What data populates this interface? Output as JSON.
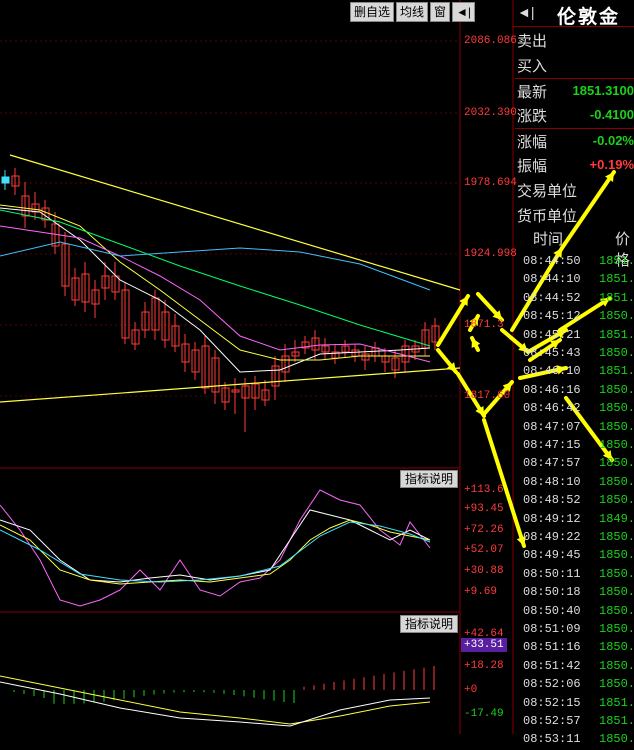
{
  "toolbar": {
    "buttons": [
      "删自选",
      "均线",
      "窗",
      "◄|"
    ]
  },
  "price_axis": [
    "2086.086",
    "2032.390",
    "1978.694",
    "1924.998",
    "1871.3",
    "1817.60"
  ],
  "indicator1": {
    "button": "指标说明",
    "labels": [
      "+113.6",
      "+93.45",
      "+72.26",
      "+52.07",
      "+30.88",
      "+9.69"
    ]
  },
  "indicator2": {
    "button": "指标说明",
    "labels": [
      "+42.64",
      "+33.51",
      "+18.28",
      "+0",
      "-17.49"
    ]
  },
  "quote_panel": {
    "title": "伦敦金",
    "rows": [
      {
        "label": "卖出",
        "value": ""
      },
      {
        "label": "买入",
        "value": ""
      },
      {
        "label": "最新",
        "value": "1851.3100",
        "color": "#19d219"
      },
      {
        "label": "涨跌",
        "value": "-0.4100",
        "color": "#19d219"
      },
      {
        "label": "涨幅",
        "value": "-0.02%",
        "color": "#19d219"
      },
      {
        "label": "振幅",
        "value": "+0.19%",
        "color": "#ff3b3b"
      },
      {
        "label": "交易单位",
        "value": ""
      },
      {
        "label": "货币单位",
        "value": ""
      }
    ]
  },
  "ticks": {
    "head_time": "时间",
    "head_price": "价格",
    "rows": [
      {
        "time": "08:44:50",
        "price": "1851."
      },
      {
        "time": "08:44:10",
        "price": "1851."
      },
      {
        "time": "08:44:52",
        "price": "1851."
      },
      {
        "time": "08:45:12",
        "price": "1850."
      },
      {
        "time": "08:45:21",
        "price": "1851."
      },
      {
        "time": "08:45:43",
        "price": "1850."
      },
      {
        "time": "08:46:10",
        "price": "1851."
      },
      {
        "time": "08:46:16",
        "price": "1850."
      },
      {
        "time": "08:46:42",
        "price": "1850."
      },
      {
        "time": "08:47:07",
        "price": "1850."
      },
      {
        "time": "08:47:15",
        "price": "1850."
      },
      {
        "time": "08:47:57",
        "price": "1850."
      },
      {
        "time": "08:48:10",
        "price": "1850."
      },
      {
        "time": "08:48:52",
        "price": "1850."
      },
      {
        "time": "08:49:12",
        "price": "1849."
      },
      {
        "time": "08:49:22",
        "price": "1850."
      },
      {
        "time": "08:49:45",
        "price": "1850."
      },
      {
        "time": "08:50:11",
        "price": "1850."
      },
      {
        "time": "08:50:18",
        "price": "1850."
      },
      {
        "time": "08:50:40",
        "price": "1850."
      },
      {
        "time": "08:51:09",
        "price": "1850."
      },
      {
        "time": "08:51:16",
        "price": "1850."
      },
      {
        "time": "08:51:42",
        "price": "1850."
      },
      {
        "time": "08:52:06",
        "price": "1850."
      },
      {
        "time": "08:52:15",
        "price": "1851."
      },
      {
        "time": "08:52:57",
        "price": "1851."
      },
      {
        "time": "08:53:11",
        "price": "1850."
      }
    ]
  },
  "colors": {
    "up": "#ff3b3b",
    "down": "#19d219",
    "ma5": "#ffffff",
    "ma10": "#ffff40",
    "ma20": "#ff66ff",
    "ma60": "#00ff66",
    "ma120": "#40c0ff",
    "arrow": "#ffff00"
  }
}
